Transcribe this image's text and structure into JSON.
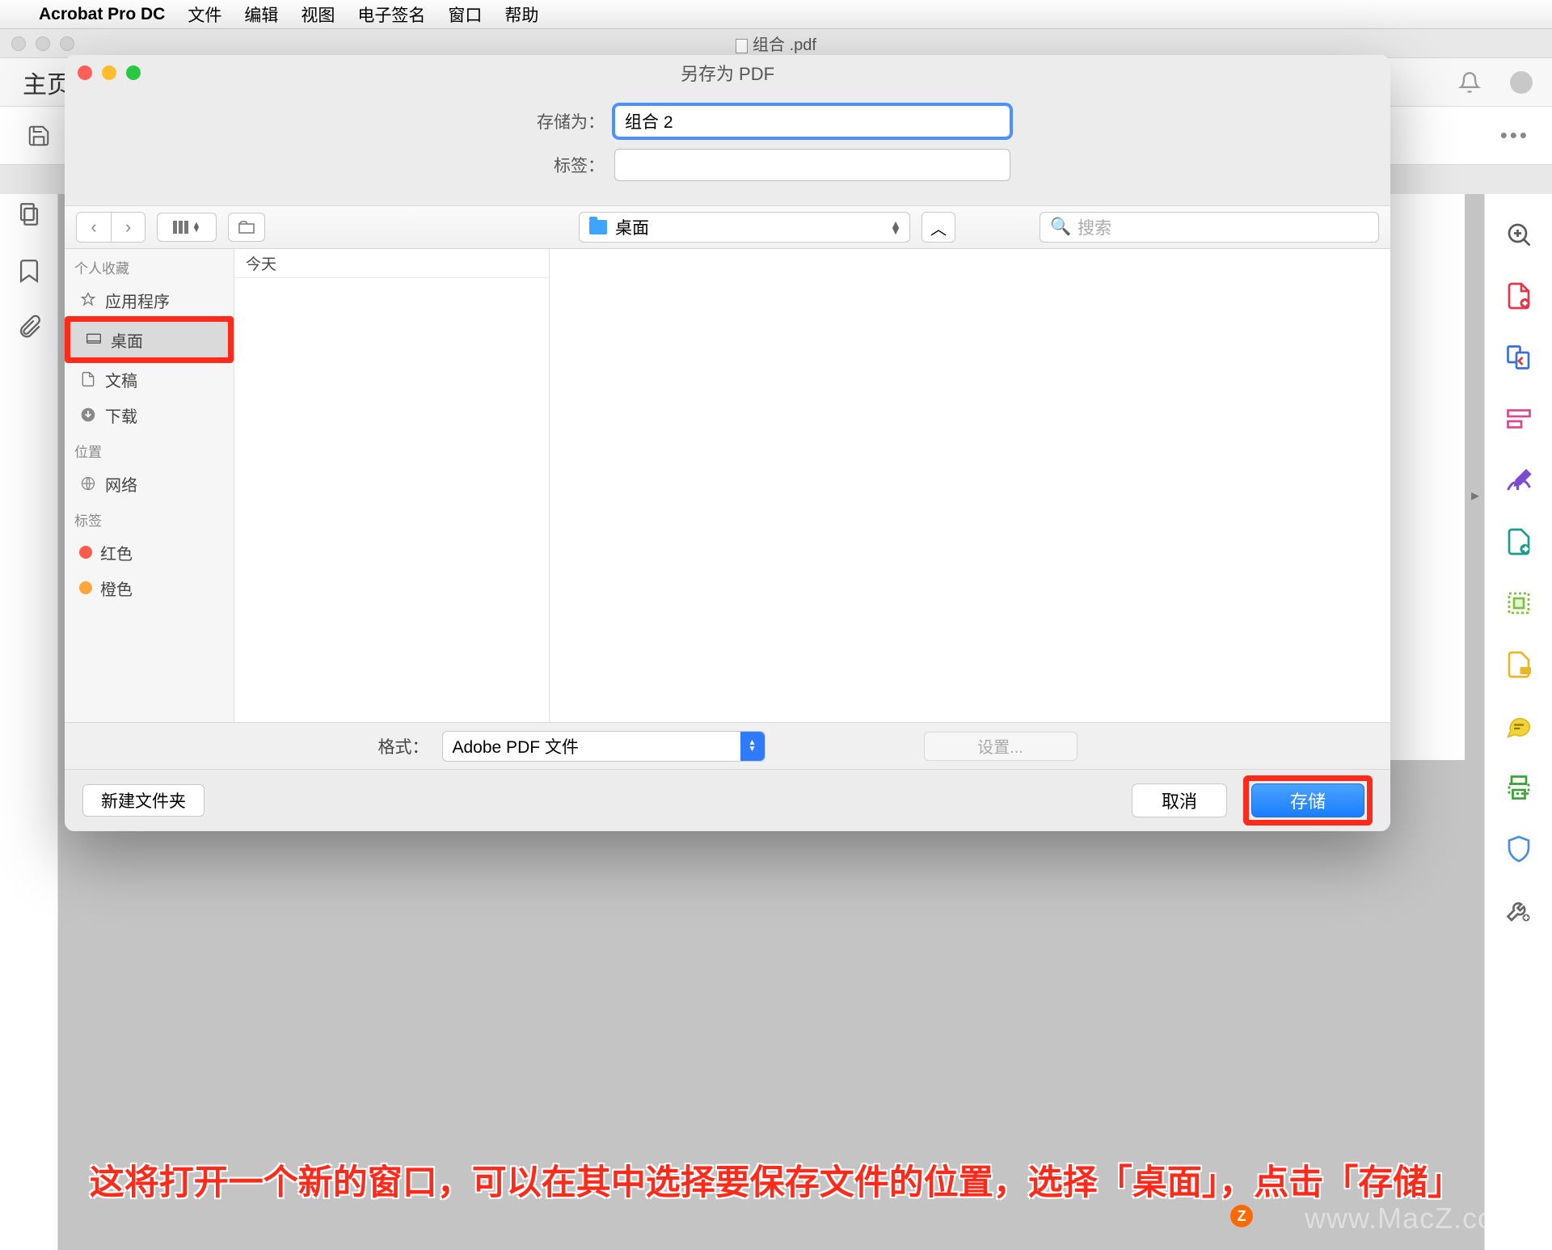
{
  "menubar": {
    "app_name": "Acrobat Pro DC",
    "items": [
      "文件",
      "编辑",
      "视图",
      "电子签名",
      "窗口",
      "帮助"
    ]
  },
  "acrobat": {
    "doc_title": "组合   .pdf",
    "home_tab": "主页",
    "ellipsis": "•••"
  },
  "dialog": {
    "title": "另存为 PDF",
    "save_as_label": "存储为：",
    "save_as_value": "组合 2",
    "tags_label": "标签：",
    "tags_value": "",
    "path_value": "桌面",
    "search_placeholder": "搜索",
    "sidebar": {
      "favorites_header": "个人收藏",
      "favorites": [
        "应用程序",
        "桌面",
        "文稿",
        "下载"
      ],
      "locations_header": "位置",
      "locations": [
        "网络"
      ],
      "tags_header": "标签",
      "tags": [
        "红色",
        "橙色"
      ]
    },
    "column_header": "今天",
    "format_label": "格式：",
    "format_value": "Adobe PDF 文件",
    "settings_button": "设置...",
    "new_folder": "新建文件夹",
    "cancel": "取消",
    "save": "存储"
  },
  "overlay": {
    "instruction": "这将打开一个新的窗口，可以在其中选择要保存文件的位置，选择「桌面」，点击「存储」",
    "watermark": "www.MacZ.com",
    "badge": "Z"
  }
}
